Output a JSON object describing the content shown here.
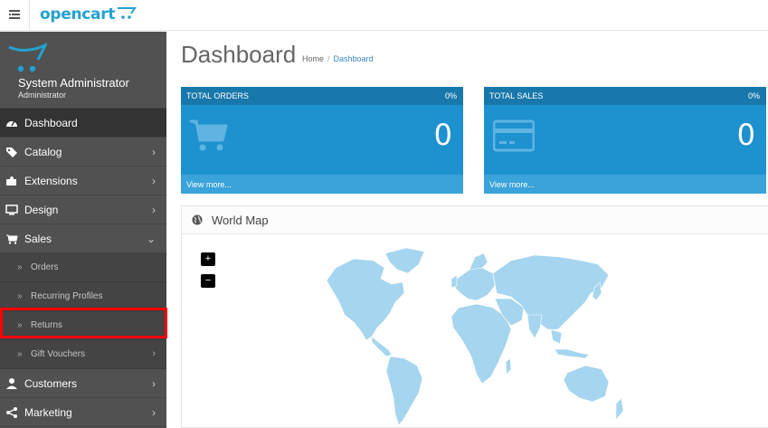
{
  "header": {
    "brand": "opencart",
    "brand_color": "#23a1d1"
  },
  "profile": {
    "name": "System Administrator",
    "role": "Administrator"
  },
  "nav": {
    "dashboard": "Dashboard",
    "catalog": "Catalog",
    "extensions": "Extensions",
    "design": "Design",
    "sales": "Sales",
    "sales_children": {
      "orders": "Orders",
      "recurring": "Recurring Profiles",
      "returns": "Returns",
      "vouchers": "Gift Vouchers"
    },
    "customers": "Customers",
    "marketing": "Marketing"
  },
  "page": {
    "title": "Dashboard",
    "breadcrumb_home": "Home",
    "breadcrumb_sep": "/",
    "breadcrumb_current": "Dashboard"
  },
  "tiles": {
    "orders": {
      "title": "TOTAL ORDERS",
      "percent": "0%",
      "value": "0",
      "link": "View more..."
    },
    "sales": {
      "title": "TOTAL SALES",
      "percent": "0%",
      "value": "0",
      "link": "View more..."
    }
  },
  "map": {
    "title": "World Map",
    "zoom_in": "+",
    "zoom_out": "−"
  },
  "colors": {
    "tile_bg": "#1e91cf",
    "tile_head": "#1978ab",
    "sidebar_bg": "#515151",
    "highlight": "#ff0000",
    "map_land": "#a5d5ef"
  }
}
